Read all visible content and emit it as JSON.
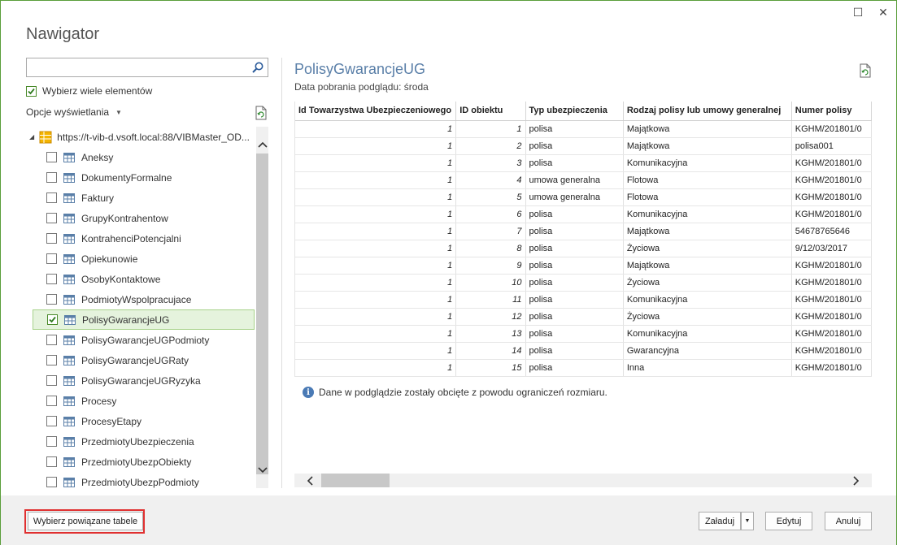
{
  "window": {
    "title": "Nawigator",
    "restore_glyph": "☐",
    "close_glyph": "✕"
  },
  "left": {
    "search_value": "",
    "search_placeholder": "",
    "multi_select_label": "Wybierz wiele elementów",
    "multi_select_checked": true,
    "display_options_label": "Opcje wyświetlania",
    "root_label": "https://t-vib-d.vsoft.local:88/VIBMaster_OD...",
    "items": [
      {
        "label": "Aneksy",
        "checked": false
      },
      {
        "label": "DokumentyFormalne",
        "checked": false
      },
      {
        "label": "Faktury",
        "checked": false
      },
      {
        "label": "GrupyKontrahentow",
        "checked": false
      },
      {
        "label": "KontrahenciPotencjalni",
        "checked": false
      },
      {
        "label": "Opiekunowie",
        "checked": false
      },
      {
        "label": "OsobyKontaktowe",
        "checked": false
      },
      {
        "label": "PodmiotyWspolpracujace",
        "checked": false
      },
      {
        "label": "PolisyGwarancjeUG",
        "checked": true
      },
      {
        "label": "PolisyGwarancjeUGPodmioty",
        "checked": false
      },
      {
        "label": "PolisyGwarancjeUGRaty",
        "checked": false
      },
      {
        "label": "PolisyGwarancjeUGRyzyka",
        "checked": false
      },
      {
        "label": "Procesy",
        "checked": false
      },
      {
        "label": "ProcesyEtapy",
        "checked": false
      },
      {
        "label": "PrzedmiotyUbezpieczenia",
        "checked": false
      },
      {
        "label": "PrzedmiotyUbezpObiekty",
        "checked": false
      },
      {
        "label": "PrzedmiotyUbezpPodmioty",
        "checked": false
      }
    ]
  },
  "preview": {
    "title": "PolisyGwarancjeUG",
    "subtitle": "Data pobrania podglądu: środa",
    "columns": [
      "Id Towarzystwa Ubezpieczeniowego",
      "ID obiektu",
      "Typ ubezpieczenia",
      "Rodzaj polisy lub umowy generalnej",
      "Numer polisy"
    ],
    "rows": [
      [
        "1",
        "1",
        "polisa",
        "Majątkowa",
        "KGHM/201801/0"
      ],
      [
        "1",
        "2",
        "polisa",
        "Majątkowa",
        "polisa001"
      ],
      [
        "1",
        "3",
        "polisa",
        "Komunikacyjna",
        "KGHM/201801/0"
      ],
      [
        "1",
        "4",
        "umowa generalna",
        "Flotowa",
        "KGHM/201801/0"
      ],
      [
        "1",
        "5",
        "umowa generalna",
        "Flotowa",
        "KGHM/201801/0"
      ],
      [
        "1",
        "6",
        "polisa",
        "Komunikacyjna",
        "KGHM/201801/0"
      ],
      [
        "1",
        "7",
        "polisa",
        "Majątkowa",
        "54678765646"
      ],
      [
        "1",
        "8",
        "polisa",
        "Życiowa",
        "9/12/03/2017"
      ],
      [
        "1",
        "9",
        "polisa",
        "Majątkowa",
        "KGHM/201801/0"
      ],
      [
        "1",
        "10",
        "polisa",
        "Życiowa",
        "KGHM/201801/0"
      ],
      [
        "1",
        "11",
        "polisa",
        "Komunikacyjna",
        "KGHM/201801/0"
      ],
      [
        "1",
        "12",
        "polisa",
        "Życiowa",
        "KGHM/201801/0"
      ],
      [
        "1",
        "13",
        "polisa",
        "Komunikacyjna",
        "KGHM/201801/0"
      ],
      [
        "1",
        "14",
        "polisa",
        "Gwarancyjna",
        "KGHM/201801/0"
      ],
      [
        "1",
        "15",
        "polisa",
        "Inna",
        "KGHM/201801/0"
      ]
    ],
    "truncated_note": "Dane w podglądzie zostały obcięte z powodu ograniczeń rozmiaru."
  },
  "footer": {
    "related_tables_label": "Wybierz powiązane tabele",
    "load_label": "Załaduj",
    "edit_label": "Edytuj",
    "cancel_label": "Anuluj"
  },
  "colors": {
    "window_border": "#5a9e3a",
    "selection_bg": "#e5f3dd",
    "highlight_red": "#e03030",
    "title_blue": "#5a7fa8"
  },
  "icons": [
    "search-icon",
    "refresh-icon",
    "table-icon",
    "info-icon",
    "checkbox-icon",
    "chevron-up-icon",
    "chevron-down-icon"
  ]
}
